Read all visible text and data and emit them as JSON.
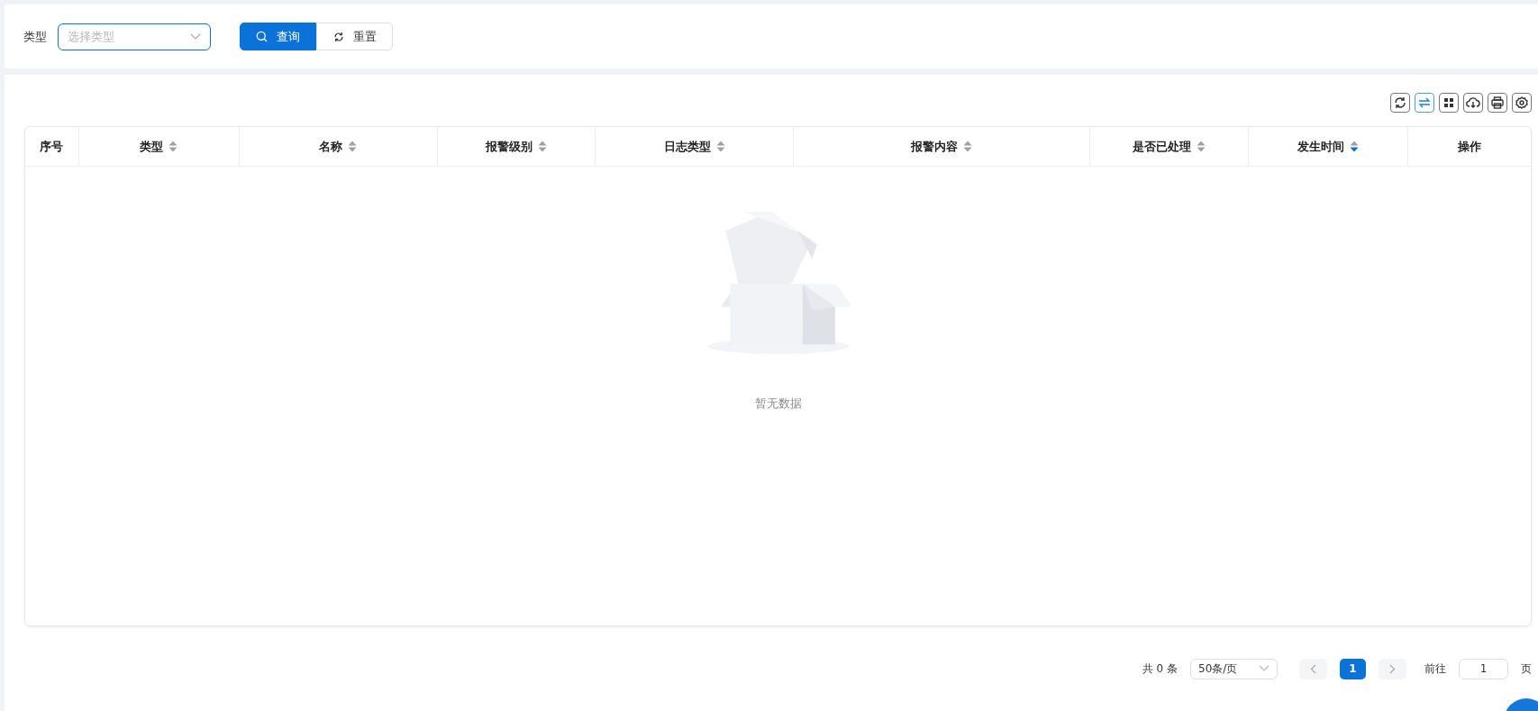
{
  "filter": {
    "label": "类型",
    "select": {
      "placeholder": "选择类型"
    },
    "buttons": [
      {
        "kind": "search",
        "label": "查询"
      },
      {
        "kind": "reset",
        "label": "重置"
      }
    ]
  },
  "toolbar": [
    {
      "kind": "refresh",
      "active": false
    },
    {
      "kind": "swap",
      "active": true
    },
    {
      "kind": "grid",
      "active": false
    },
    {
      "kind": "download",
      "active": false
    },
    {
      "kind": "print",
      "active": false
    },
    {
      "kind": "settings",
      "active": false
    }
  ],
  "table": {
    "columns": [
      {
        "label": "序号",
        "sortable": false
      },
      {
        "label": "类型",
        "sortable": true,
        "sorted_desc": false
      },
      {
        "label": "名称",
        "sortable": true,
        "sorted_desc": false
      },
      {
        "label": "报警级别",
        "sortable": true,
        "sorted_desc": false
      },
      {
        "label": "日志类型",
        "sortable": true,
        "sorted_desc": false
      },
      {
        "label": "报警内容",
        "sortable": true,
        "sorted_desc": false
      },
      {
        "label": "是否已处理",
        "sortable": true,
        "sorted_desc": false
      },
      {
        "label": "发生时间",
        "sortable": true,
        "sorted_desc": true
      },
      {
        "label": "操作",
        "sortable": false
      }
    ],
    "empty_text": "暂无数据"
  },
  "pagination": {
    "total": "共 0 条",
    "page_size": "50条/页",
    "pages": [
      {
        "label": "1",
        "selected": true
      }
    ],
    "goto_label": "前往",
    "goto_value": "1",
    "page_suffix": "页"
  }
}
